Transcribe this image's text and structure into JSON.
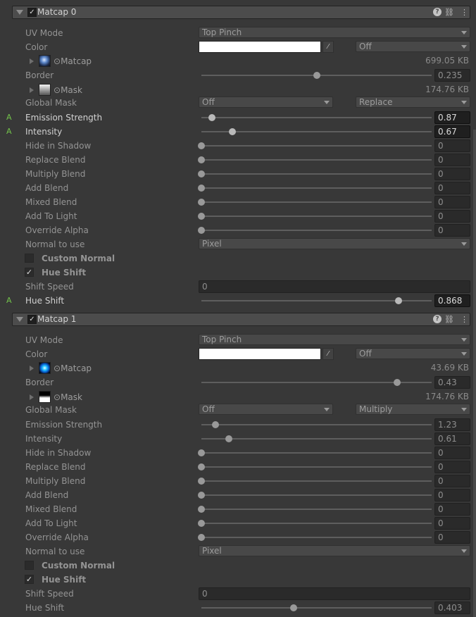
{
  "labels": {
    "uv_mode": "UV Mode",
    "color": "Color",
    "matcap_tex": "Matcap",
    "border": "Border",
    "mask_tex": "Mask",
    "global_mask": "Global Mask",
    "emission_strength": "Emission Strength",
    "intensity": "Intensity",
    "hide_in_shadow": "Hide in Shadow",
    "replace_blend": "Replace Blend",
    "multiply_blend": "Multiply Blend",
    "add_blend": "Add Blend",
    "mixed_blend": "Mixed Blend",
    "add_to_light": "Add To Light",
    "override_alpha": "Override Alpha",
    "normal_to_use": "Normal to use",
    "custom_normal": "Custom Normal",
    "hue_shift_toggle": "Hue Shift",
    "shift_speed": "Shift Speed",
    "hue_shift": "Hue Shift",
    "animated_mark": "A",
    "checkmark": "✓",
    "help_glyph": "?",
    "link_glyph": "⛓",
    "menu_glyph": "⋮",
    "texture_picker_glyph": "⊙",
    "eyedropper_glyph": "⁄"
  },
  "colors": {
    "panel_bg": "#383838",
    "header_bg": "#4c4c4c",
    "animated_green": "#72c24a",
    "swatch": "#ffffff"
  },
  "matcaps": [
    {
      "title": "Matcap 0",
      "enabled": true,
      "uv_mode": "Top Pinch",
      "color_mode": "Off",
      "matcap_size": "699.05 KB",
      "border": {
        "value": "0.235",
        "pos": 0.5
      },
      "mask_size": "174.76 KB",
      "global_mask": "Off",
      "global_mask_blend": "Replace",
      "emission_strength": {
        "value": "0.87",
        "pos": 0.045,
        "animated": true
      },
      "intensity": {
        "value": "0.67",
        "pos": 0.134,
        "animated": true
      },
      "hide_in_shadow": {
        "value": "0",
        "pos": 0
      },
      "replace_blend": {
        "value": "0",
        "pos": 0
      },
      "multiply_blend": {
        "value": "0",
        "pos": 0
      },
      "add_blend": {
        "value": "0",
        "pos": 0
      },
      "mixed_blend": {
        "value": "0",
        "pos": 0
      },
      "add_to_light": {
        "value": "0",
        "pos": 0
      },
      "override_alpha": {
        "value": "0",
        "pos": 0
      },
      "normal_to_use": "Pixel",
      "custom_normal": false,
      "hue_shift_enabled": true,
      "shift_speed": "0",
      "hue_shift": {
        "value": "0.868",
        "pos": 0.856,
        "animated": true
      }
    },
    {
      "title": "Matcap 1",
      "enabled": true,
      "uv_mode": "Top Pinch",
      "color_mode": "Off",
      "matcap_size": "43.69 KB",
      "border": {
        "value": "0.43",
        "pos": 0.85
      },
      "mask_size": "174.76 KB",
      "global_mask": "Off",
      "global_mask_blend": "Multiply",
      "emission_strength": {
        "value": "1.23",
        "pos": 0.06,
        "animated": false
      },
      "intensity": {
        "value": "0.61",
        "pos": 0.12,
        "animated": false
      },
      "hide_in_shadow": {
        "value": "0",
        "pos": 0
      },
      "replace_blend": {
        "value": "0",
        "pos": 0
      },
      "multiply_blend": {
        "value": "0",
        "pos": 0
      },
      "add_blend": {
        "value": "0",
        "pos": 0
      },
      "mixed_blend": {
        "value": "0",
        "pos": 0
      },
      "add_to_light": {
        "value": "0",
        "pos": 0
      },
      "override_alpha": {
        "value": "0",
        "pos": 0
      },
      "normal_to_use": "Pixel",
      "custom_normal": false,
      "hue_shift_enabled": true,
      "shift_speed": "0",
      "hue_shift": {
        "value": "0.403",
        "pos": 0.4,
        "animated": false
      }
    }
  ]
}
